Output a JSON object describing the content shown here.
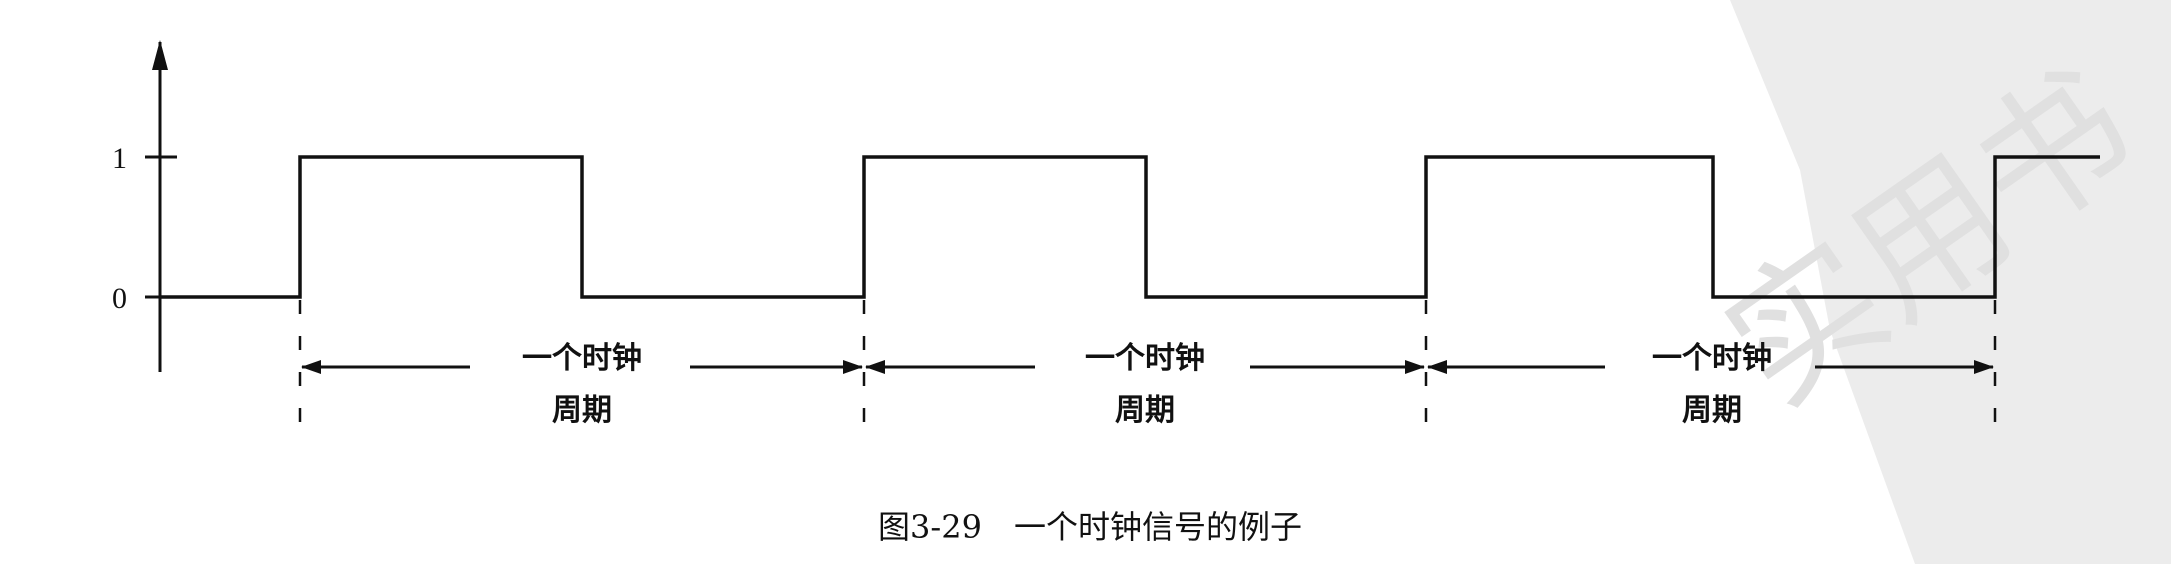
{
  "figure": {
    "y_ticks": [
      "1",
      "0"
    ],
    "period_labels": [
      {
        "line1": "一个时钟",
        "line2": "周期"
      },
      {
        "line1": "一个时钟",
        "line2": "周期"
      },
      {
        "line1": "一个时钟",
        "line2": "周期"
      }
    ],
    "caption": "图3-29　一个时钟信号的例子",
    "watermark_text": "实用书"
  },
  "colors": {
    "ink": "#111111",
    "watermark": "#e6e6e6"
  }
}
